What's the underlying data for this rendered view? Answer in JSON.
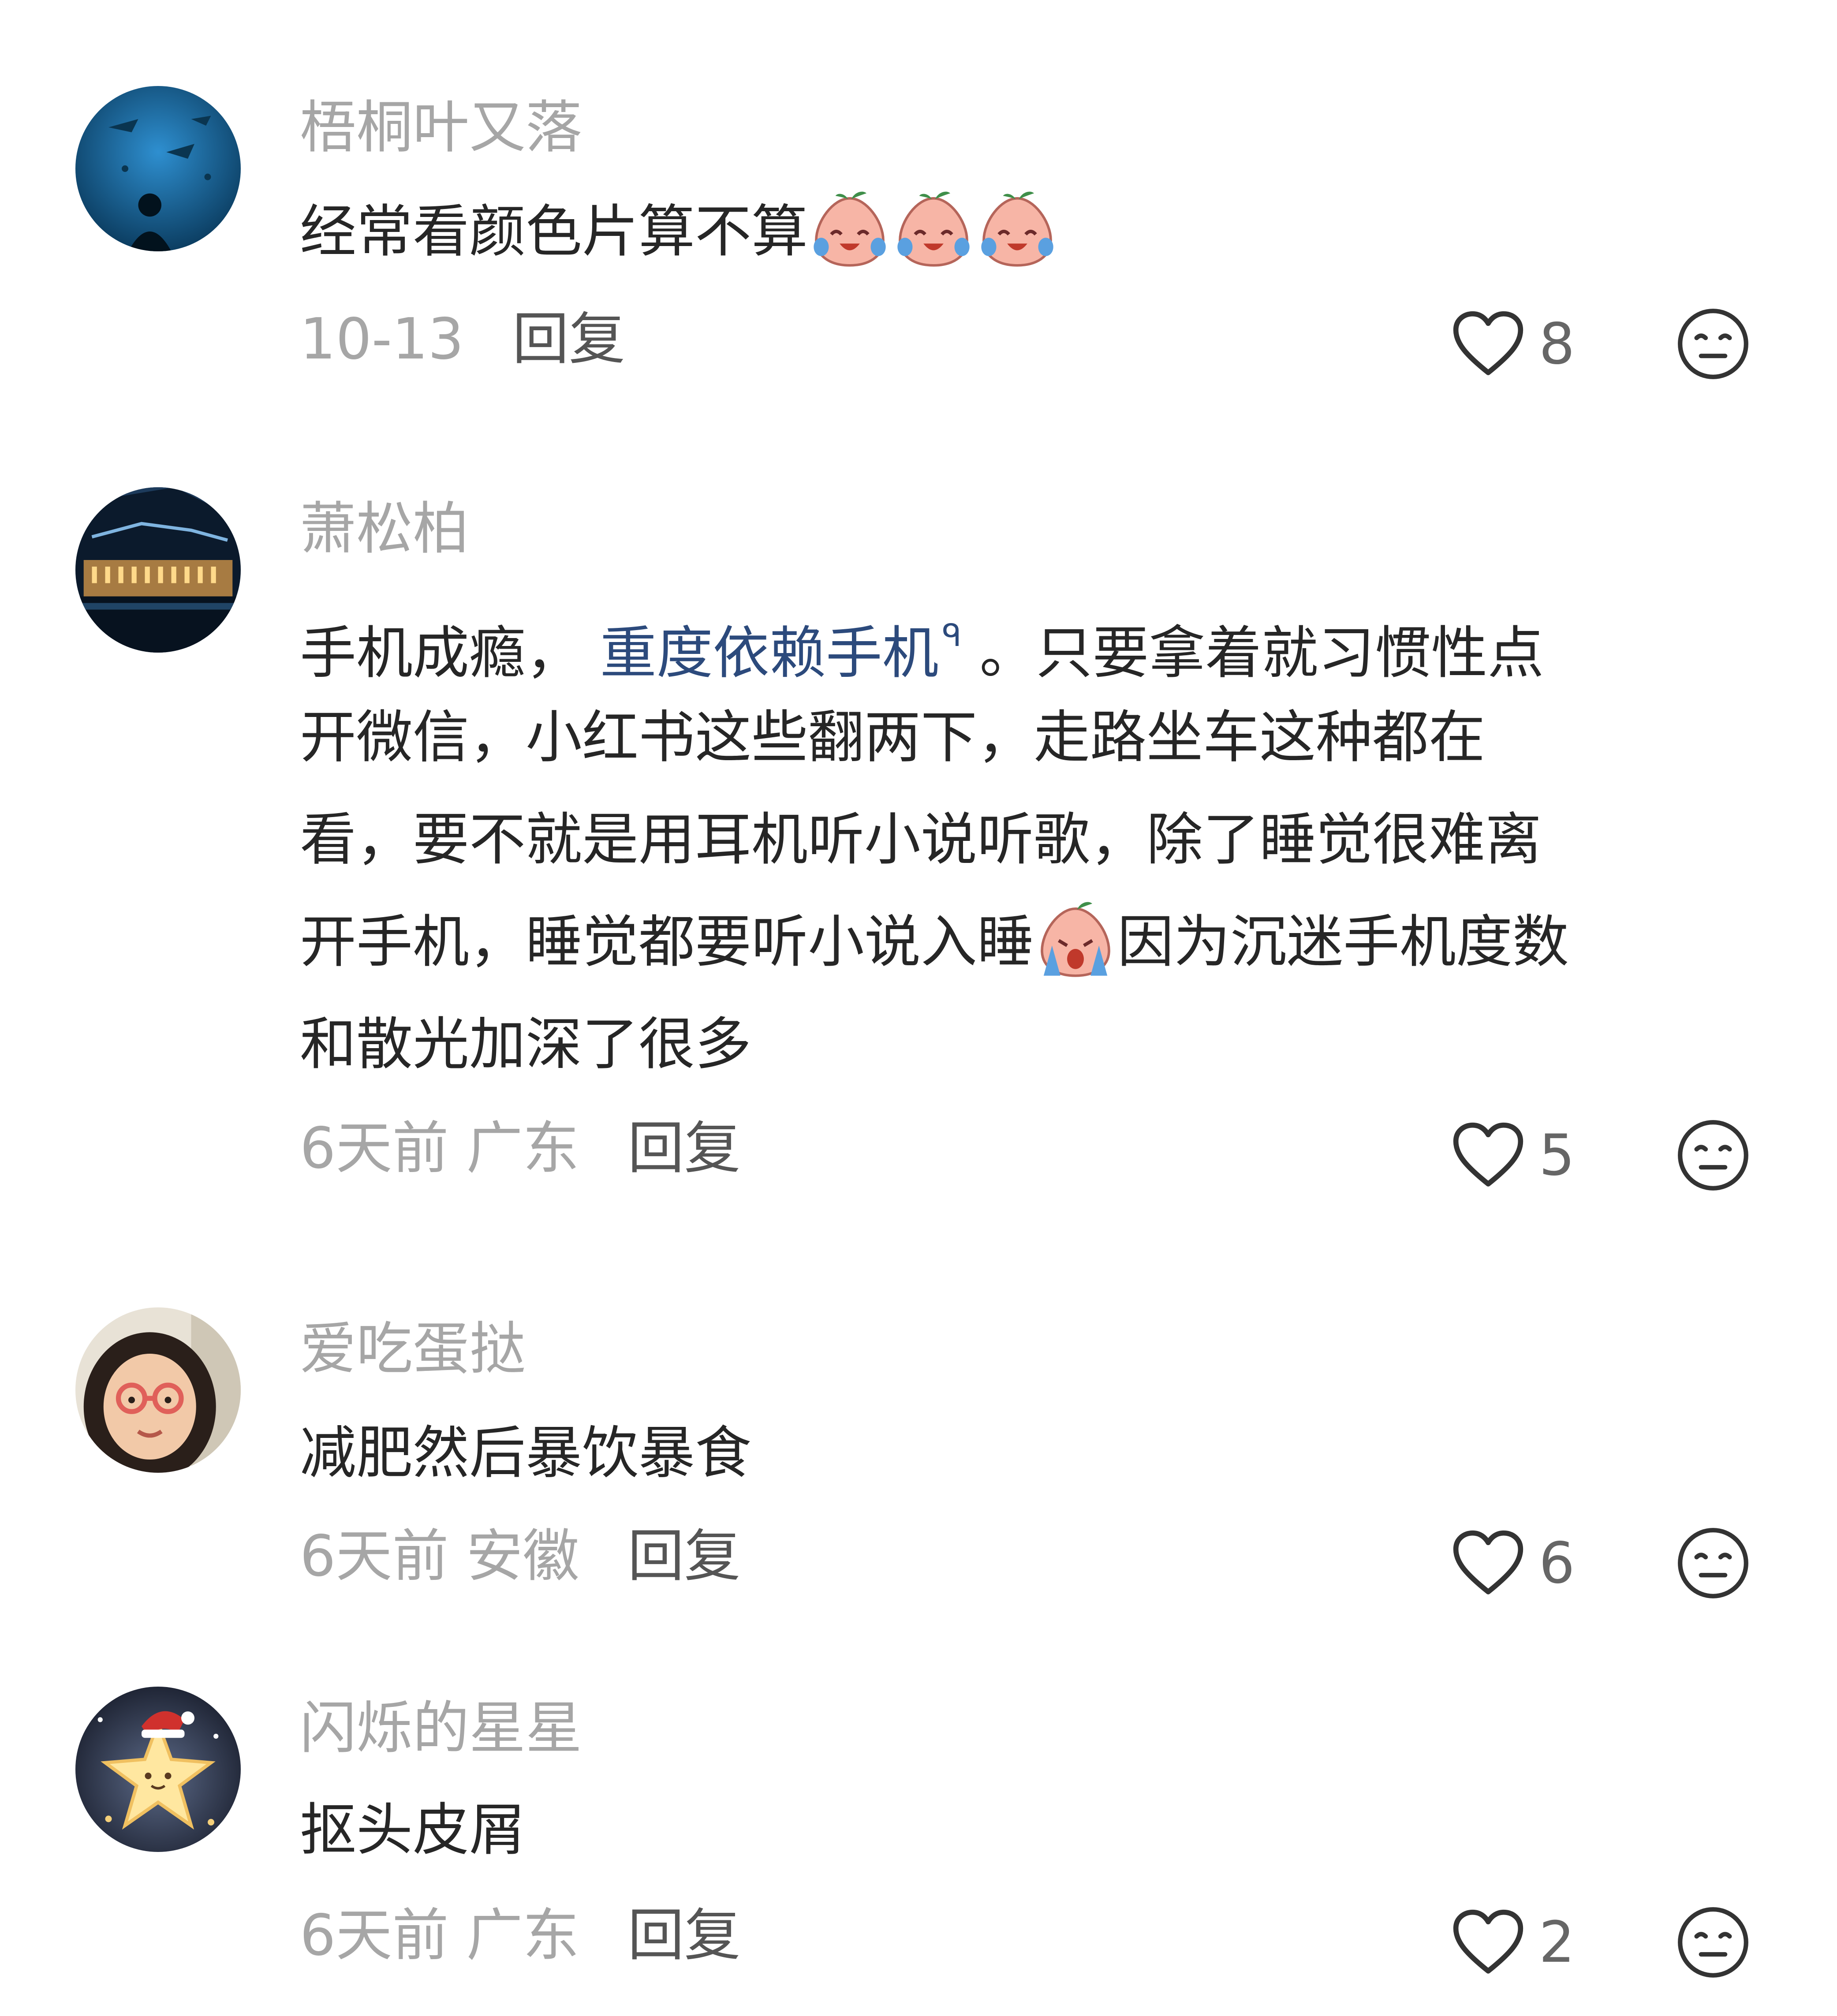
{
  "comments": [
    {
      "username": "梧桐叶又落",
      "lines": [
        "经常看颜色片算不算"
      ],
      "date": "10-13",
      "location": "",
      "reply_label": "回复",
      "likes": "8",
      "avatar": "aquarium-silhouette"
    },
    {
      "username": "萧松柏",
      "line1_prefix": "手机成瘾， ",
      "search_link": "重度依赖手机",
      "line1_suffix": " 。只要拿着就习惯性点",
      "line2": "开微信，小红书这些翻两下，走路坐车这种都在",
      "line3": "看，要不就是用耳机听小说听歌，除了睡觉很难离",
      "line4_prefix": "开手机，睡觉都要听小说入睡",
      "line4_suffix": "因为沉迷手机度数",
      "line5": "和散光加深了很多",
      "date": "6天前",
      "location": "广东",
      "reply_label": "回复",
      "likes": "5",
      "avatar": "night-building"
    },
    {
      "username": "爱吃蛋挞",
      "lines": [
        "减肥然后暴饮暴食"
      ],
      "date": "6天前",
      "location": "安徽",
      "reply_label": "回复",
      "likes": "6",
      "avatar": "girl-with-glasses"
    },
    {
      "username": "闪烁的星星",
      "lines": [
        "抠头皮屑"
      ],
      "date": "6天前",
      "location": "广东",
      "reply_label": "回复",
      "likes": "2",
      "avatar": "star-with-santa-hat"
    }
  ],
  "icons": {
    "like": "heart-outline-icon",
    "dislike": "neutral-face-icon",
    "emoji_laugh_cry": "laugh-cry-peach-emoji",
    "emoji_cry": "crying-peach-emoji",
    "search": "search-mini-icon"
  },
  "colors": {
    "username": "#a6a6a6",
    "text": "#262626",
    "link": "#2c4a7c",
    "meta": "#a6a6a6",
    "reply": "#555555"
  }
}
